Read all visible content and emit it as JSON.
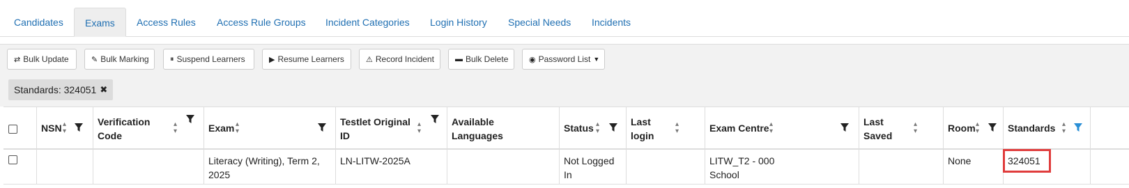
{
  "tabs": [
    {
      "label": "Candidates",
      "active": false
    },
    {
      "label": "Exams",
      "active": true
    },
    {
      "label": "Access Rules",
      "active": false
    },
    {
      "label": "Access Rule Groups",
      "active": false
    },
    {
      "label": "Incident Categories",
      "active": false
    },
    {
      "label": "Login History",
      "active": false
    },
    {
      "label": "Special Needs",
      "active": false
    },
    {
      "label": "Incidents",
      "active": false
    }
  ],
  "toolbar": {
    "bulk_update": "Bulk Update",
    "bulk_marking": "Bulk Marking",
    "suspend_learners": "Suspend Learners",
    "resume_learners": "Resume Learners",
    "record_incident": "Record Incident",
    "bulk_delete": "Bulk Delete",
    "password_list": "Password List"
  },
  "filter_chip": {
    "label": "Standards: 324051"
  },
  "table": {
    "headers": {
      "nsn": "NSN",
      "verification_code_1": "Verification",
      "verification_code_2": "Code",
      "exam": "Exam",
      "testlet_1": "Testlet Original",
      "testlet_2": "ID",
      "languages_1": "Available",
      "languages_2": "Languages",
      "status": "Status",
      "last_login_1": "Last",
      "last_login_2": "login",
      "exam_centre": "Exam Centre",
      "last_saved_1": "Last",
      "last_saved_2": "Saved",
      "room": "Room",
      "standards": "Standards"
    },
    "rows": [
      {
        "nsn": "",
        "verification_code": "",
        "exam_1": "Literacy (Writing), Term 2,",
        "exam_2": "2025",
        "testlet_id": "LN-LITW-2025A",
        "languages": "",
        "status_1": "Not Logged",
        "status_2": "In",
        "last_login": "",
        "exam_centre_1": "LITW_T2 - 000",
        "exam_centre_2": "School",
        "last_saved": "",
        "room": "None",
        "standards": "324051"
      }
    ]
  },
  "colors": {
    "link": "#1f6fb2",
    "active_filter": "#2a8fd6",
    "highlight": "#e03c3c"
  }
}
